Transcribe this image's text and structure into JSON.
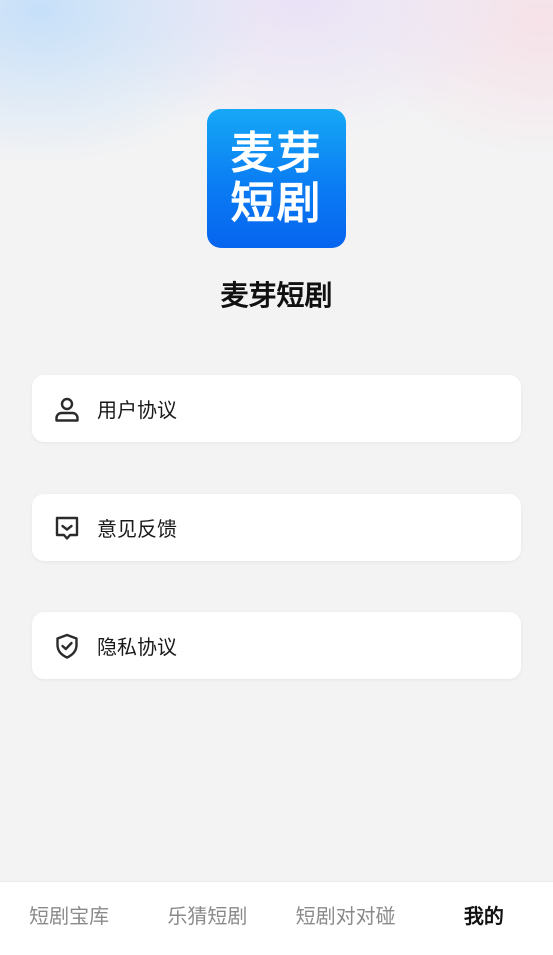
{
  "app": {
    "logo_line1": "麦芽",
    "logo_line2": "短剧",
    "name": "麦芽短剧",
    "logo_colors": [
      "#16a8f6",
      "#0664ef"
    ]
  },
  "menu": {
    "items": [
      {
        "label": "用户协议",
        "icon": "user-icon"
      },
      {
        "label": "意见反馈",
        "icon": "feedback-icon"
      },
      {
        "label": "隐私协议",
        "icon": "shield-check-icon"
      }
    ]
  },
  "tabs": {
    "items": [
      {
        "label": "短剧宝库",
        "active": false
      },
      {
        "label": "乐猜短剧",
        "active": false
      },
      {
        "label": "短剧对对碰",
        "active": false
      },
      {
        "label": "我的",
        "active": true
      }
    ]
  }
}
